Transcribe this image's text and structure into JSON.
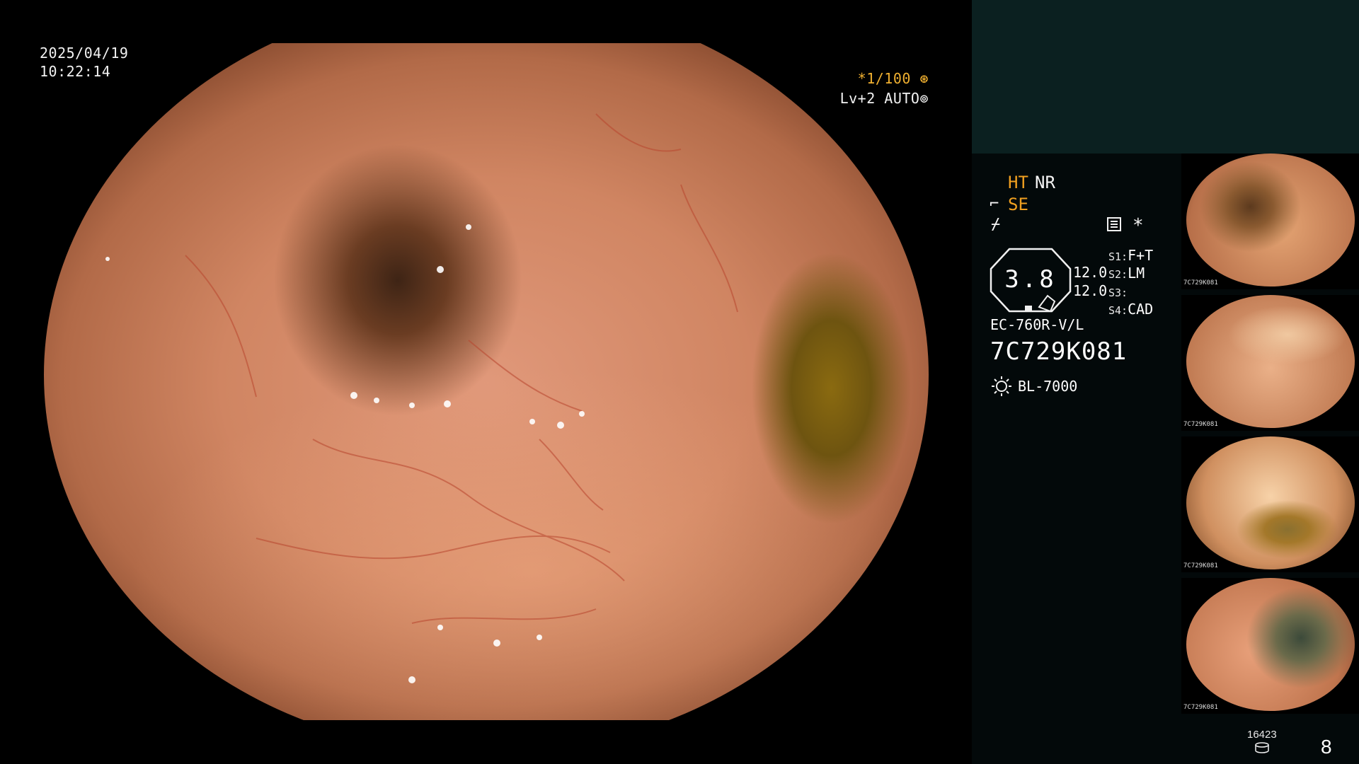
{
  "overlay": {
    "date": "2025/04/19",
    "time": "10:22:14",
    "shutter": "*1/100",
    "level": "Lv+2 AUTO"
  },
  "icons": {
    "shutter_icon": "aperture-icon",
    "auto_icon": "iris-icon",
    "se_icon": "structure-enhancement-icon",
    "enh_icon": "edge-enhancement-icon",
    "memo_icon": "memo-icon",
    "light_icon": "light-source-icon",
    "storage_icon": "disk-icon"
  },
  "panel": {
    "ht": "HT",
    "nr": "NR",
    "se": "SE",
    "star": "*",
    "zoom": "3.8",
    "val_a": "12.0",
    "val_b": "12.0",
    "switches": [
      {
        "key": "S1:",
        "value": "F+T"
      },
      {
        "key": "S2:",
        "value": "LM"
      },
      {
        "key": "S3:",
        "value": ""
      },
      {
        "key": "S4:",
        "value": "CAD"
      }
    ],
    "scope_model": "EC-760R-V/L",
    "serial": "7C729K081",
    "light_model": "BL-7000"
  },
  "thumbnails": [
    {
      "tag": "7C729K081"
    },
    {
      "tag": "7C729K081"
    },
    {
      "tag": "7C729K081"
    },
    {
      "tag": "7C729K081"
    }
  ],
  "footer": {
    "count_small": "16423",
    "count_big": "8"
  },
  "colors": {
    "accent_orange": "#f0a020",
    "panel_top": "#0b2020",
    "panel_bg": "#03090a"
  }
}
